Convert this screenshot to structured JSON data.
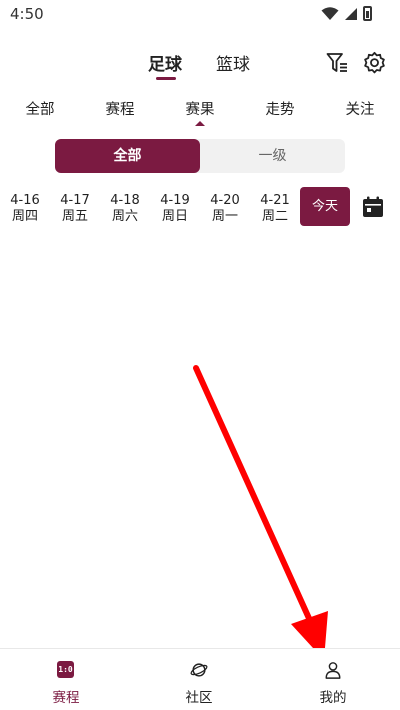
{
  "status": {
    "time": "4:50"
  },
  "sport_tabs": [
    "足球",
    "篮球"
  ],
  "sub_tabs": [
    "全部",
    "赛程",
    "赛果",
    "走势",
    "关注"
  ],
  "segmented": {
    "active": "全部",
    "inactive": "一级"
  },
  "dates": [
    {
      "date": "4-16",
      "weekday": "周四"
    },
    {
      "date": "4-17",
      "weekday": "周五"
    },
    {
      "date": "4-18",
      "weekday": "周六"
    },
    {
      "date": "4-19",
      "weekday": "周日"
    },
    {
      "date": "4-20",
      "weekday": "周一"
    },
    {
      "date": "4-21",
      "weekday": "周二"
    }
  ],
  "today_label": "今天",
  "bottom_nav": [
    {
      "label": "赛程",
      "icon": "score-badge-icon",
      "badge_text": "1:0"
    },
    {
      "label": "社区",
      "icon": "planet-icon"
    },
    {
      "label": "我的",
      "icon": "person-icon"
    }
  ],
  "colors": {
    "accent": "#7b1a41",
    "arrow": "#ff0000"
  },
  "icons": [
    "wifi-icon",
    "signal-icon",
    "battery-icon",
    "filter-icon",
    "gear-icon",
    "calendar-icon",
    "arrow-annotation"
  ]
}
